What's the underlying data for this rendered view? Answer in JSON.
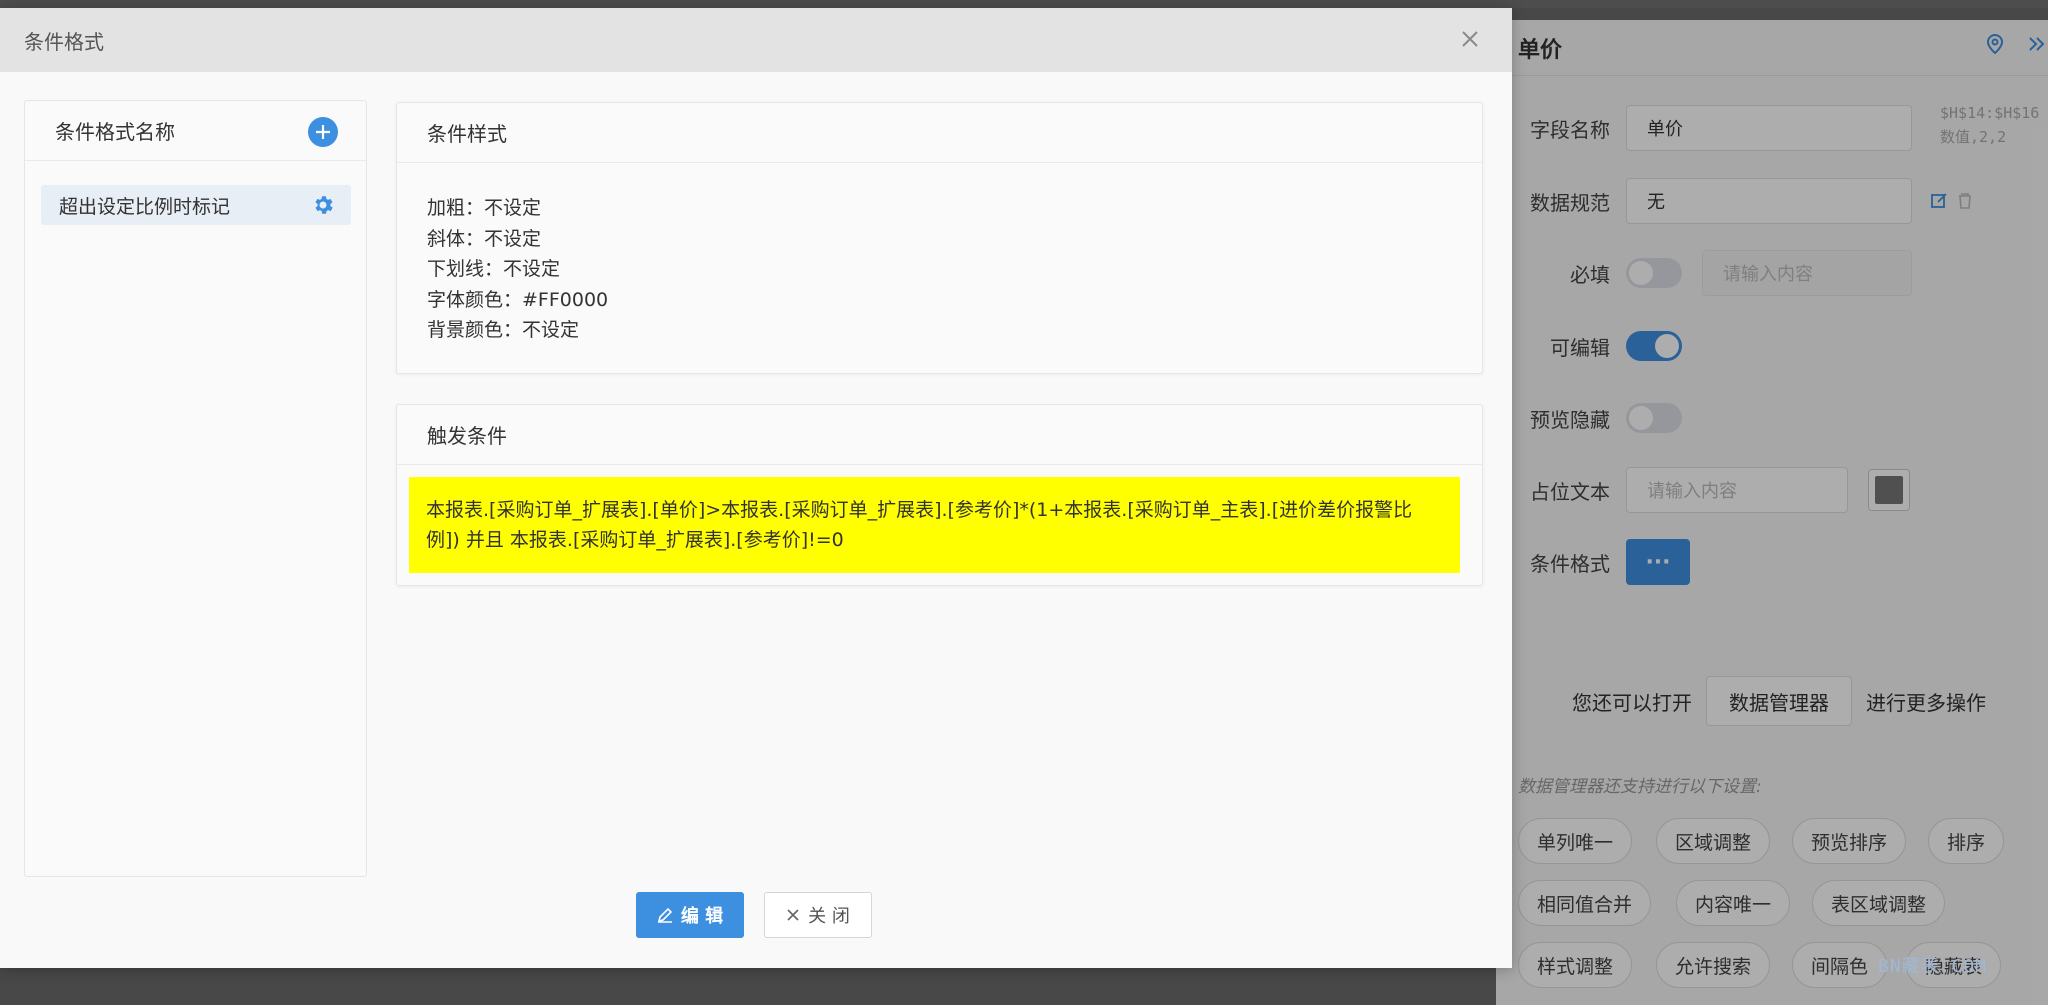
{
  "bg_panel": {
    "title": "单价",
    "ref_line1": "$H$14:$H$16",
    "ref_line2": "数值,2,2",
    "field_name_label": "字段名称",
    "field_name_value": "单价",
    "spec_label": "数据规范",
    "spec_value": "无",
    "required_label": "必填",
    "required_placeholder": "请输入内容",
    "editable_label": "可编辑",
    "preview_hide_label": "预览隐藏",
    "placeholder_label": "占位文本",
    "placeholder_input": "请输入内容",
    "cond_format_label": "条件格式",
    "cond_format_btn": "···",
    "more_prefix": "您还可以打开",
    "data_manager_btn": "数据管理器",
    "more_suffix": "进行更多操作",
    "hint": "数据管理器还支持进行以下设置:",
    "chips": [
      "单列唯一",
      "区域调整",
      "预览排序",
      "排序",
      "相同值合并",
      "内容唯一",
      "表区域调整",
      "样式调整",
      "允许搜索",
      "间隔色",
      "隐藏表"
    ],
    "accent_color": "#3d8fe0"
  },
  "dialog": {
    "title": "条件格式",
    "close_icon": "close-icon",
    "left": {
      "heading": "条件格式名称",
      "item": "超出设定比例时标记"
    },
    "style_card": {
      "heading": "条件样式",
      "lines": [
        "加粗：不设定",
        "斜体：不设定",
        "下划线：不设定",
        "字体颜色：#FF0000",
        "背景颜色：不设定"
      ]
    },
    "trigger_card": {
      "heading": "触发条件",
      "line1": "本报表.[采购订单_扩展表].[单价]>本报表.[采购订单_扩展表].[参考价]*(1+本报表.[采购订单_主表].[进价差价报警比",
      "line2": "例]) 并且 本报表.[采购订单_扩展表].[参考价]!=0",
      "highlight_color": "#ffff00"
    },
    "edit_btn": "编 辑",
    "close_btn": "关 闭"
  },
  "watermark": "BN藏表.COM"
}
